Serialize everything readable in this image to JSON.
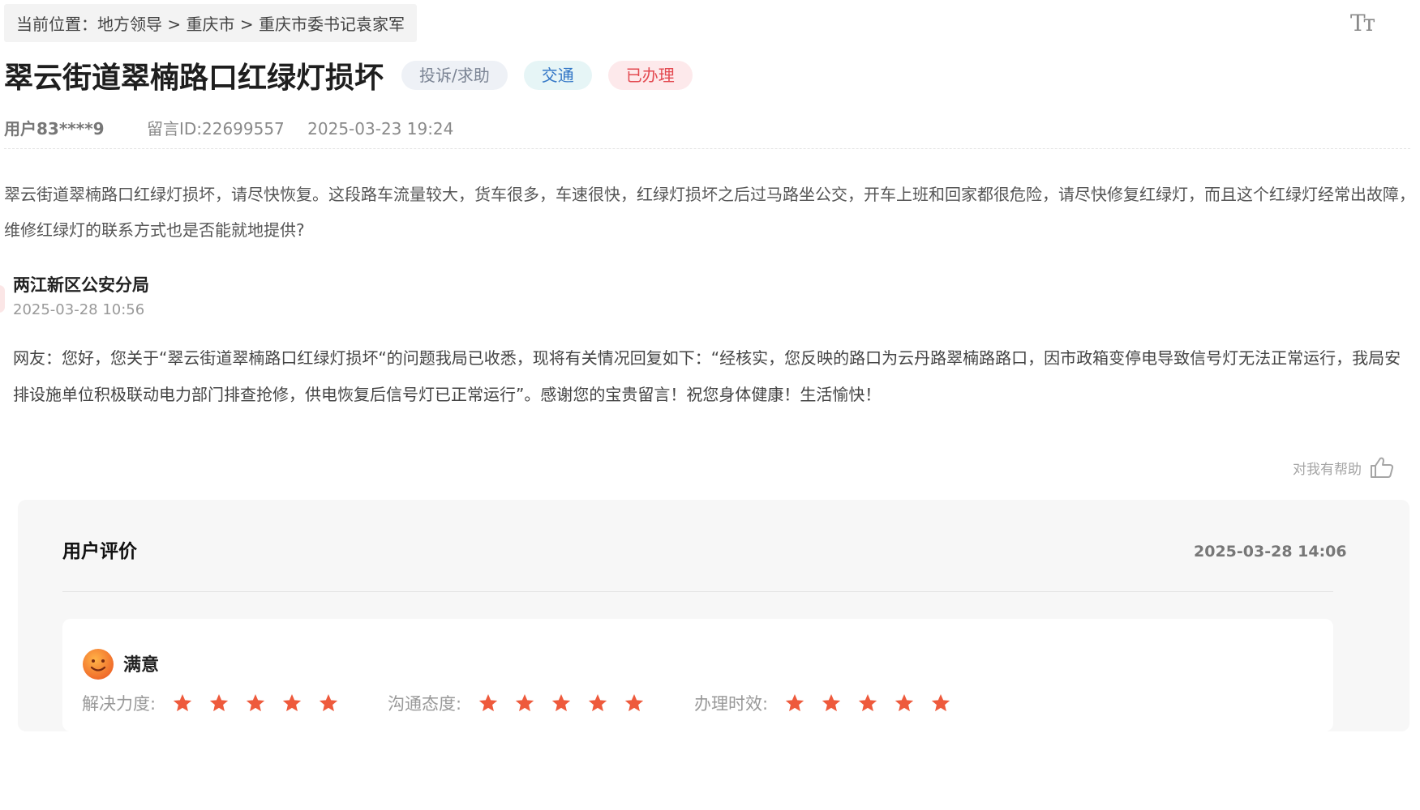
{
  "breadcrumb": "当前位置：地方领导 > 重庆市 > 重庆市委书记袁家军",
  "toolbar": {
    "font_size_label": "Tт"
  },
  "post": {
    "title": "翠云街道翠楠路口红绿灯损坏",
    "tags": {
      "type": "投诉/求助",
      "topic": "交通",
      "status": "已办理"
    },
    "user": "用户83****9",
    "message_id": "留言ID:22699557",
    "datetime": "2025-03-23 19:24",
    "content": "翠云街道翠楠路口红绿灯损坏，请尽快恢复。这段路车流量较大，货车很多，车速很快，红绿灯损坏之后过马路坐公交，开车上班和回家都很危险，请尽快修复红绿灯，而且这个红绿灯经常出故障，维修红绿灯的联系方式也是否能就地提供?"
  },
  "reply": {
    "org": "两江新区公安分局",
    "datetime": "2025-03-28 10:56",
    "content": "网友：您好，您关于“翠云街道翠楠路口红绿灯损坏“的问题我局已收悉，现将有关情况回复如下：“经核实，您反映的路口为云丹路翠楠路路口，因市政箱变停电导致信号灯无法正常运行，我局安排设施单位积极联动电力部门排查抢修，供电恢复后信号灯已正常运行”。感谢您的宝贵留言！祝您身体健康！生活愉快！",
    "helpful_label": "对我有帮助"
  },
  "evaluation": {
    "title": "用户评价",
    "datetime": "2025-03-28 14:06",
    "satisfaction": "满意",
    "ratings": [
      {
        "label": "解决力度:",
        "stars": 5,
        "max": 5
      },
      {
        "label": "沟通态度:",
        "stars": 5,
        "max": 5
      },
      {
        "label": "办理时效:",
        "stars": 5,
        "max": 5
      }
    ]
  },
  "colors": {
    "star": "#ee5a3c",
    "smiley": "#f2762f",
    "status_red": "#e34950",
    "topic_blue": "#3276c6"
  },
  "icons": {
    "font_size": "text-size-icon",
    "helpful": "thumbs-up-icon",
    "smiley": "smiley-face-icon",
    "star": "star-icon"
  }
}
